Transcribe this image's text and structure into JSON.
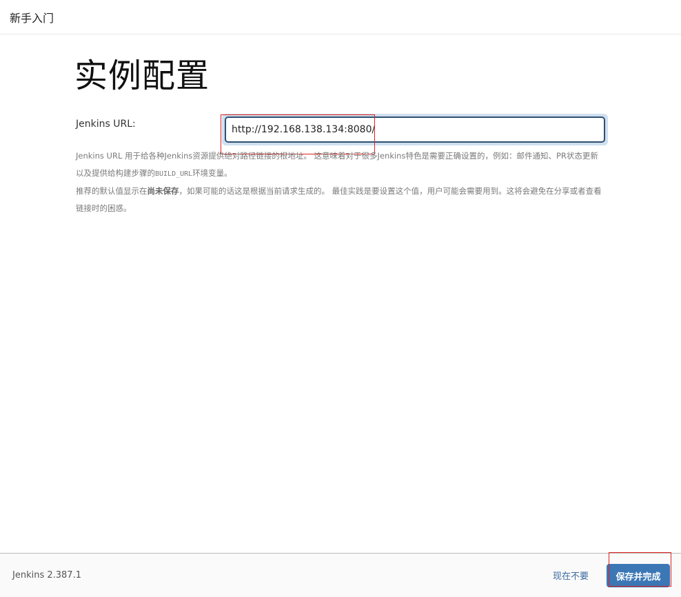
{
  "header": {
    "title": "新手入门"
  },
  "main": {
    "page_title": "实例配置",
    "url_label": "Jenkins URL:",
    "url_value": "http://192.168.138.134:8080/",
    "help": {
      "p1_a": "Jenkins URL 用于给各种Jenkins资源提供绝对路径链接的根地址。 这意味着对于很多Jenkins特色是需要正确设置的，例如：邮件通知、PR状态更新以及提供给构建步骤的",
      "p1_code": "BUILD_URL",
      "p1_b": "环境变量。",
      "p2_a": "推荐的默认值显示在",
      "p2_bold": "尚未保存",
      "p2_b": "，如果可能的话这是根据当前请求生成的。 最佳实践是要设置这个值，用户可能会需要用到。这将会避免在分享或者查看链接时的困惑。"
    }
  },
  "footer": {
    "version": "Jenkins 2.387.1",
    "skip_label": "现在不要",
    "save_label": "保存并完成"
  },
  "colors": {
    "primary_button": "#3b77b5",
    "link": "#3b6aa0",
    "annotation": "#e02020"
  }
}
